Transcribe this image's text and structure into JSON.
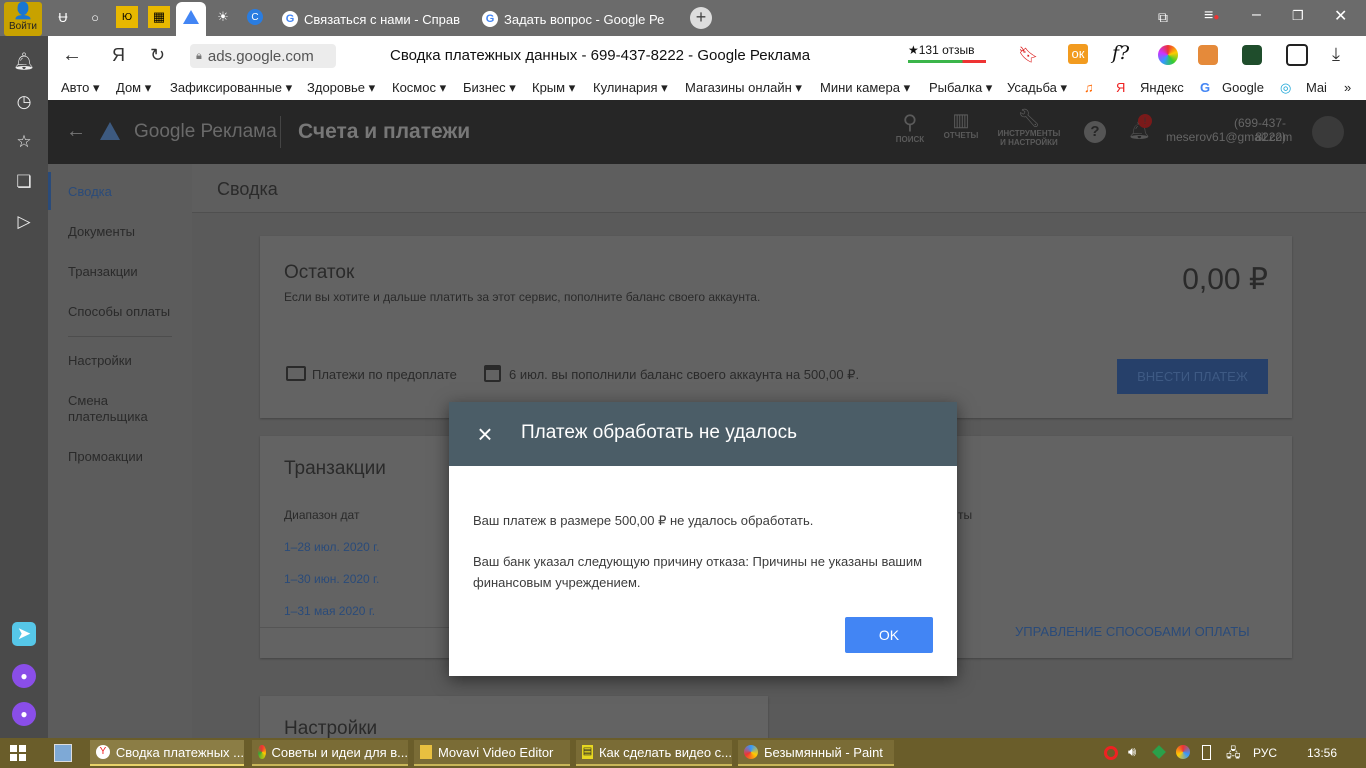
{
  "browser": {
    "login_label": "Войти",
    "tabs": [
      {
        "label": "Связаться с нами - Справ"
      },
      {
        "label": "Задать вопрос - Google Ре"
      }
    ],
    "address": "ads.google.com",
    "page_title": "Сводка платежных данных - 699-437-8222 - Google Реклама",
    "reviews": "★131 отзыв",
    "bookmarks": [
      "Авто ▾",
      "Дом ▾",
      "Зафиксированные ▾",
      "Здоровье ▾",
      "Космос ▾",
      "Бизнес ▾",
      "Крым ▾",
      "Кулинария ▾",
      "Магазины онлайн ▾",
      "Мини камера ▾",
      "Рыбалка ▾",
      "Усадьба ▾",
      "Яндекс",
      "Google",
      "Mai"
    ]
  },
  "app": {
    "brand": "Google Реклама",
    "section_title": "Счета и платежи",
    "header_icons": {
      "search": "ПОИСК",
      "reports": "ОТЧЕТЫ",
      "tools_line1": "ИНСТРУМЕНТЫ",
      "tools_line2": "И НАСТРОЙКИ"
    },
    "account_id": "(699-437-8222)",
    "account_email": "meserov61@gmail.com",
    "nav": [
      "Сводка",
      "Документы",
      "Транзакции",
      "Способы оплаты",
      "Настройки",
      "Смена",
      "плательщика",
      "Промоакции"
    ],
    "page_heading": "Сводка",
    "balance": {
      "title": "Остаток",
      "desc": "Если вы хотите и дальше платить за этот сервис, пополните баланс своего аккаунта.",
      "amount": "0,00 ₽",
      "prepay": "Платежи по предоплате",
      "last_topup": "6 июл. вы пополнили баланс своего аккаунта на 500,00 ₽.",
      "pay_button": "ВНЕСТИ ПЛАТЕЖ"
    },
    "transactions": {
      "title": "Транзакции",
      "date_range_label": "Диапазон дат",
      "ranges": [
        "1–28 июл. 2020 г.",
        "1–30 июн. 2020 г.",
        "1–31 мая 2020 г."
      ],
      "right_partial": "ты",
      "manage_link": "УПРАВЛЕНИЕ СПОСОБАМИ ОПЛАТЫ"
    },
    "settings_title": "Настройки"
  },
  "modal": {
    "title": "Платеж обработать не удалось",
    "line1": "Ваш платеж в размере 500,00 ₽ не удалось обработать.",
    "line2": "Ваш банк указал следующую причину отказа: Причины не указаны вашим финансовым учреждением.",
    "ok_label": "OK"
  },
  "taskbar": {
    "items": [
      "Сводка платежных ...",
      "Советы и идеи для в...",
      "Movavi Video Editor",
      "Как сделать видео с...",
      "Безымянный - Paint"
    ],
    "lang": "РУС",
    "time": "13:56"
  }
}
